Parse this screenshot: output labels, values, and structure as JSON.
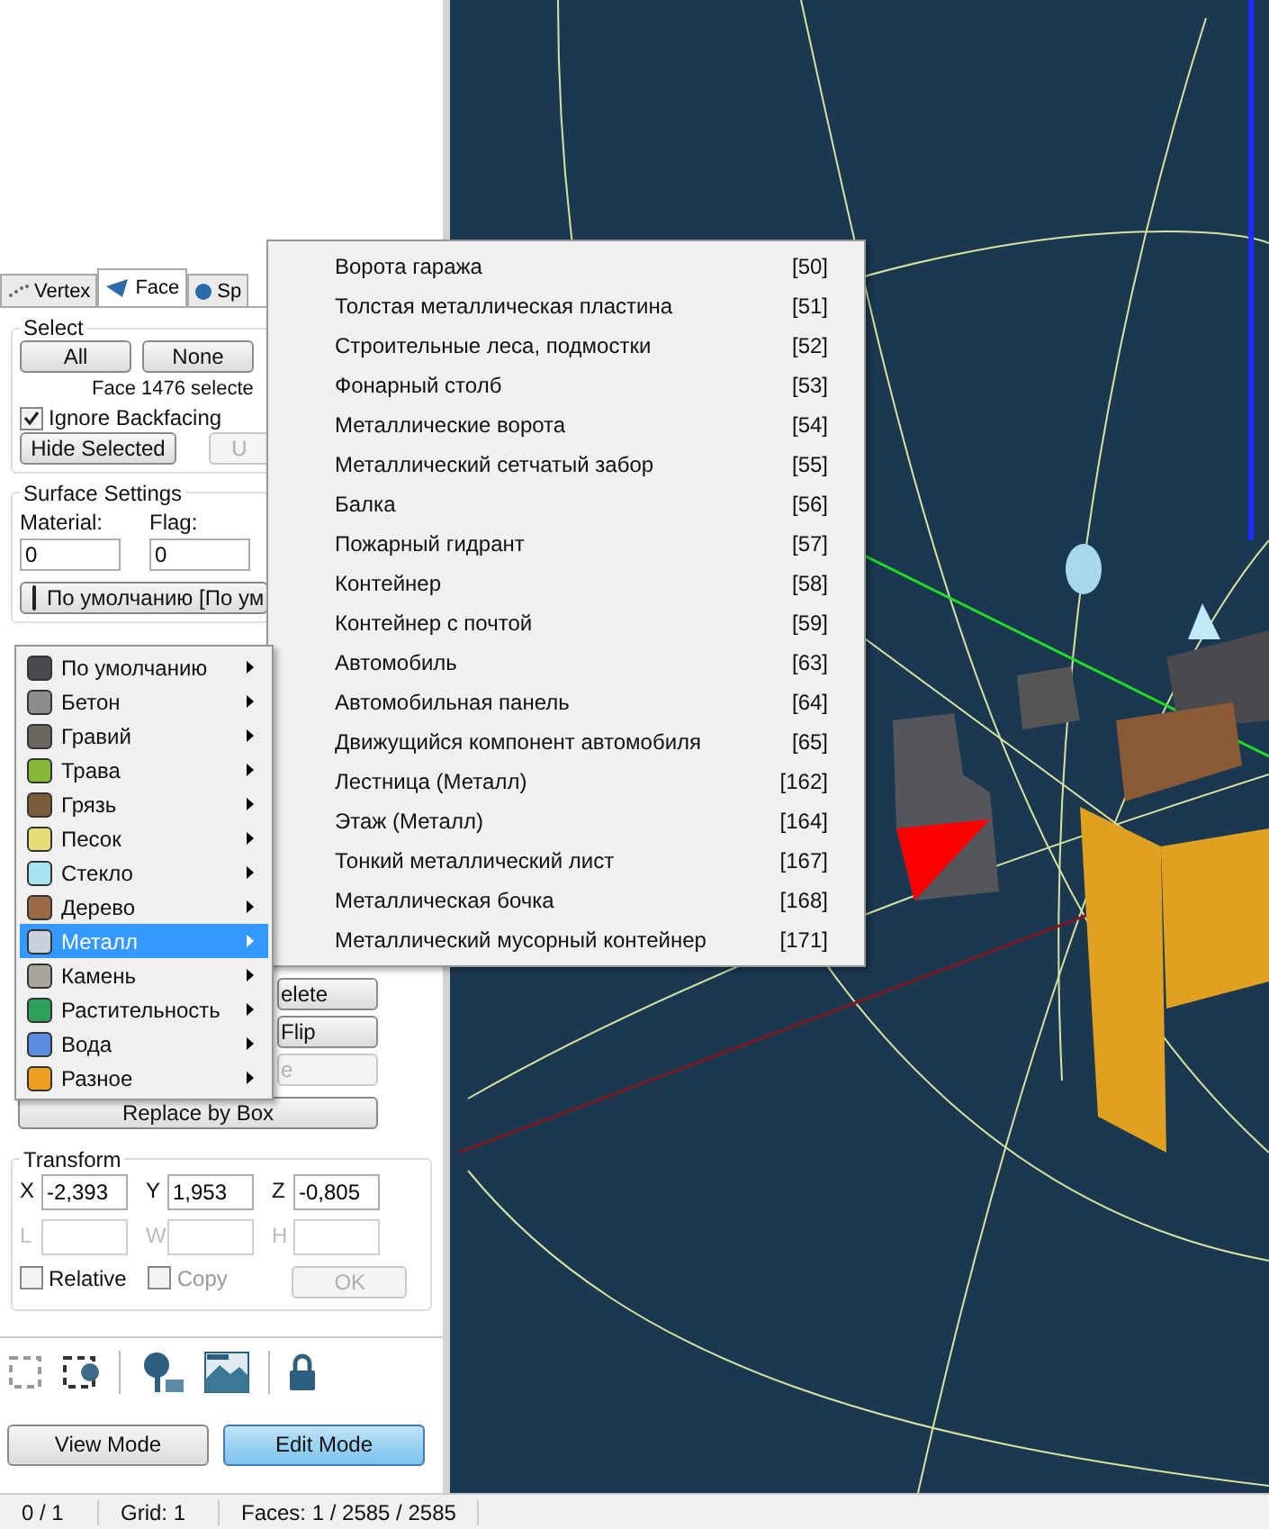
{
  "tabs": [
    {
      "label": "Vertex",
      "kind": "vertex",
      "selected": false
    },
    {
      "label": "Face",
      "kind": "face",
      "selected": true
    },
    {
      "label": "Sp",
      "kind": "sphere",
      "selected": false
    }
  ],
  "select": {
    "title": "Select",
    "buttons": [
      {
        "label": "All",
        "disabled": false
      },
      {
        "label": "None",
        "disabled": false
      }
    ],
    "status": "Face 1476 selecte",
    "ignore_backfacing": {
      "label": "Ignore Backfacing",
      "checked": true
    },
    "hide_button": "Hide Selected",
    "unhide_button": {
      "label": "U",
      "disabled": true
    }
  },
  "surface": {
    "title": "Surface Settings",
    "material_label": "Material:",
    "flag_label": "Flag:",
    "material_value": "0",
    "flag_value": "0",
    "material_button": {
      "label": "По умолчанию [По ум",
      "color": "#4a4a4e"
    }
  },
  "actions": [
    {
      "label": "elete",
      "disabled": false
    },
    {
      "label": "Flip",
      "disabled": false
    },
    {
      "label": "e",
      "disabled": true
    }
  ],
  "replace_button": "Replace by Box",
  "transform": {
    "title": "Transform",
    "fields": [
      {
        "label": "X",
        "value": "-2,393",
        "disabled": false
      },
      {
        "label": "Y",
        "value": "1,953",
        "disabled": false
      },
      {
        "label": "Z",
        "value": "-0,805",
        "disabled": false
      },
      {
        "label": "L",
        "disabled": true
      },
      {
        "label": "W",
        "disabled": true
      },
      {
        "label": "H",
        "disabled": true
      }
    ],
    "relative": {
      "label": "Relative",
      "checked": false,
      "disabled": false
    },
    "copy": {
      "label": "Copy",
      "checked": false,
      "disabled": true
    },
    "ok": {
      "label": "OK",
      "disabled": true
    }
  },
  "modes": [
    {
      "label": "View Mode",
      "selected": false
    },
    {
      "label": "Edit Mode",
      "selected": true
    }
  ],
  "status_bar": [
    "0 / 1",
    "Grid: 1",
    "Faces: 1 / 2585 / 2585"
  ],
  "material_menu": [
    {
      "label": "По умолчанию",
      "color": "#4a4a4e",
      "selected": false
    },
    {
      "label": "Бетон",
      "color": "#8c8c8c",
      "selected": false
    },
    {
      "label": "Гравий",
      "color": "#6b6860",
      "selected": false
    },
    {
      "label": "Трава",
      "color": "#86b83a",
      "selected": false
    },
    {
      "label": "Грязь",
      "color": "#7a5c3a",
      "selected": false
    },
    {
      "label": "Песок",
      "color": "#e8dc78",
      "selected": false
    },
    {
      "label": "Стекло",
      "color": "#a8e4f4",
      "selected": false
    },
    {
      "label": "Дерево",
      "color": "#9a6a44",
      "selected": false
    },
    {
      "label": "Металл",
      "color": "#c8d0dc",
      "selected": true
    },
    {
      "label": "Камень",
      "color": "#a8a49a",
      "selected": false
    },
    {
      "label": "Растительность",
      "color": "#2ea05a",
      "selected": false
    },
    {
      "label": "Вода",
      "color": "#5a8ce0",
      "selected": false
    },
    {
      "label": "Разное",
      "color": "#f0a020",
      "selected": false
    }
  ],
  "submenu": [
    {
      "label": "Ворота гаража",
      "code": "[50]"
    },
    {
      "label": "Толстая металлическая пластина",
      "code": "[51]"
    },
    {
      "label": "Строительные леса, подмостки",
      "code": "[52]"
    },
    {
      "label": "Фонарный столб",
      "code": "[53]"
    },
    {
      "label": "Металлические ворота",
      "code": "[54]"
    },
    {
      "label": "Металлический сетчатый забор",
      "code": "[55]"
    },
    {
      "label": "Балка",
      "code": "[56]"
    },
    {
      "label": "Пожарный гидрант",
      "code": "[57]"
    },
    {
      "label": "Контейнер",
      "code": "[58]"
    },
    {
      "label": "Контейнер с почтой",
      "code": "[59]"
    },
    {
      "label": "Автомобиль",
      "code": "[63]"
    },
    {
      "label": "Автомобильная панель",
      "code": "[64]"
    },
    {
      "label": "Движущийся компонент автомобиля",
      "code": "[65]"
    },
    {
      "label": "Лестница (Металл)",
      "code": "[162]"
    },
    {
      "label": "Этаж (Металл)",
      "code": "[164]"
    },
    {
      "label": "Тонкий металлический лист",
      "code": "[167]"
    },
    {
      "label": "Металлическая бочка",
      "code": "[168]"
    },
    {
      "label": "Металлический мусорный контейнер",
      "code": "[171]"
    }
  ]
}
